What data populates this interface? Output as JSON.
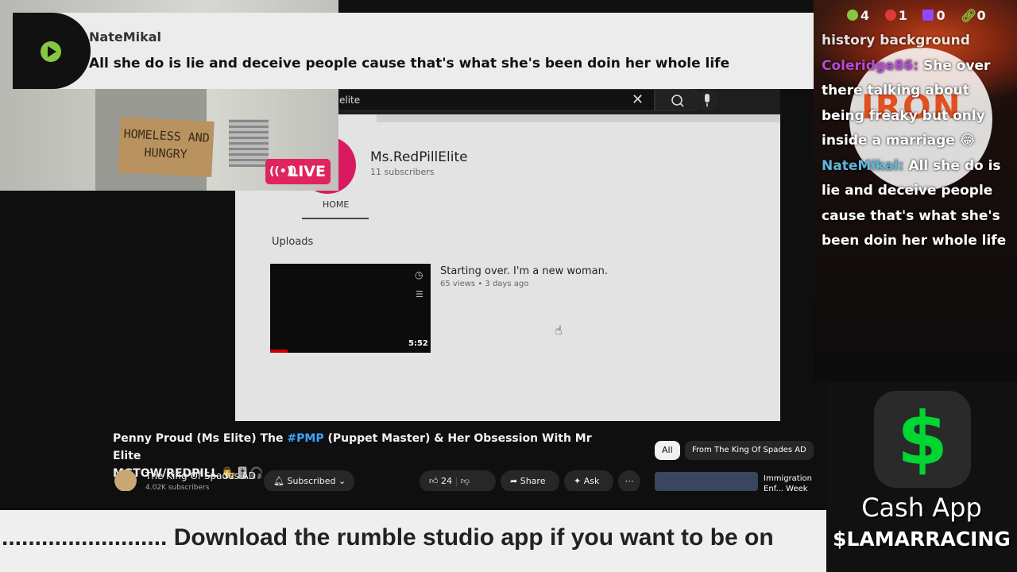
{
  "alert": {
    "username": "NateMikal",
    "message": "All she do is lie and deceive people cause that's what she's been doin her whole life"
  },
  "webcam": {
    "sign_text": "HOMELESS AND HUNGRY",
    "live_label": "LIVE"
  },
  "counters": [
    {
      "icon": "rumble-icon",
      "value": "4",
      "color": "#85c742"
    },
    {
      "icon": "locals-icon",
      "value": "1",
      "color": "#e03a3a"
    },
    {
      "icon": "twitch-icon",
      "value": "0",
      "color": "#9146ff"
    },
    {
      "icon": "link-icon",
      "value": "0",
      "color": "#85c742"
    }
  ],
  "chat": {
    "partial_prev": "history background",
    "messages": [
      {
        "user": "Coleridge86:",
        "text": "She over there talking about being freaky but only inside a marriage 😂"
      },
      {
        "user": "NateMikal:",
        "text": "All she do is lie and deceive people cause that's what she's been doin her whole life"
      }
    ]
  },
  "inner_youtube": {
    "search_value": "elite",
    "channel_name": "Ms.RedPillElite",
    "channel_subs": "11 subscribers",
    "tab_home": "HOME",
    "uploads_label": "Uploads",
    "video_title": "Starting over. I'm a new woman.",
    "video_meta": "65 views • 3 days ago",
    "video_duration": "5:52"
  },
  "video": {
    "title_pre": "Penny Proud (Ms Elite) The ",
    "title_hashtag": "#PMP",
    "title_post": " (Puppet Master) & Her Obsession With Mr Elite",
    "title_line2": "MGTOW/REDPILL 👨‍⚖️🎚️🎧",
    "channel_name": "The King Of Spades AD",
    "channel_subs": "4.02K subscribers",
    "subscribed_label": "Subscribed",
    "like_count": "24",
    "share_label": "Share",
    "ask_label": "Ask"
  },
  "chips": {
    "all": "All",
    "from": "From The King Of Spades AD"
  },
  "recommended": {
    "title": "Immigration Enf... Week Tonight wi..."
  },
  "cashapp": {
    "name": "Cash App",
    "tag": "$LAMARRACING",
    "brand_color": "#00d632"
  },
  "ticker": {
    "text": "......................... Download the rumble studio app if you want to be on"
  }
}
